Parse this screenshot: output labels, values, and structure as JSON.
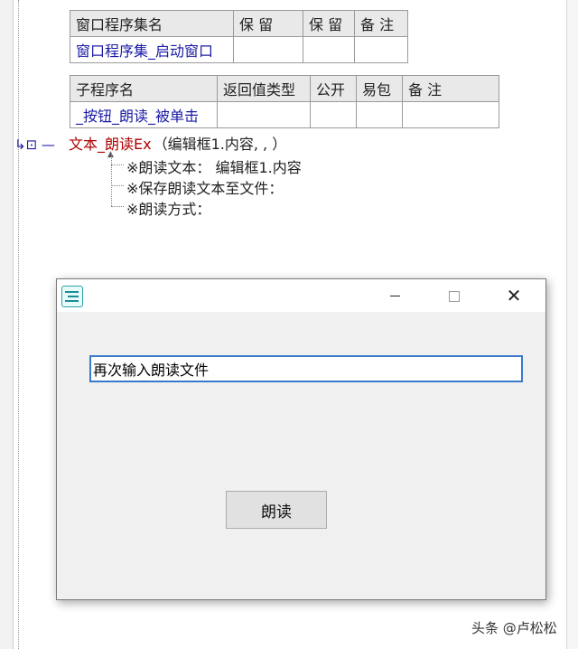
{
  "table1": {
    "headers": [
      "窗口程序集名",
      "保 留",
      "保 留",
      "备 注"
    ],
    "row": [
      "窗口程序集_启动窗口",
      "",
      "",
      ""
    ]
  },
  "table2": {
    "headers": [
      "子程序名",
      "返回值类型",
      "公开",
      "易包",
      "备 注"
    ],
    "row": [
      "_按钮_朗读_被单击",
      "",
      "",
      "",
      ""
    ]
  },
  "code": {
    "marker": "↳⊡ —",
    "command": "文本_朗读Ex",
    "args": "（编辑框1.内容, , ）",
    "params": [
      "※朗读文本：  编辑框1.内容",
      "※保存朗读文本至文件：",
      "※朗读方式："
    ]
  },
  "dialog": {
    "input_value": "再次输入朗读文件",
    "button_label": "朗读",
    "close_glyph": "✕"
  },
  "watermark": "头条 @卢松松"
}
